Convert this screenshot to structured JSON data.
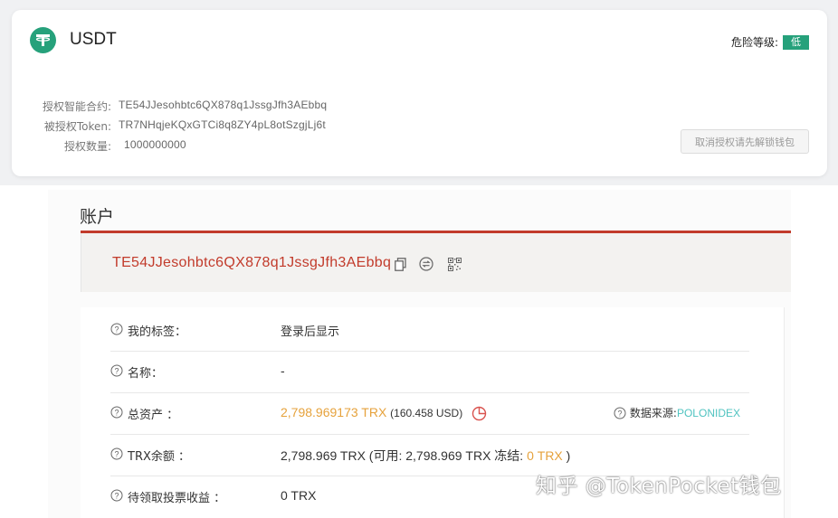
{
  "token_card": {
    "name": "USDT",
    "risk_label": "危险等级:",
    "risk_level": "低",
    "contract_label": "授权智能合约:",
    "contract_value": "TE54JJesohbtc6QX878q1JssgJfh3AEbbq",
    "token_label": "被授权Token:",
    "token_value": "TR7NHqjeKQxGTCi8q8ZY4pL8otSzgjLj6t",
    "amount_label": "授权数量:",
    "amount_value": "1000000000",
    "revoke_button": "取消授权请先解锁钱包"
  },
  "account": {
    "title": "账户",
    "address": "TE54JJesohbtc6QX878q1JssgJfh3AEbbq",
    "rows": [
      {
        "label": "我的标签：",
        "value": "登录后显示"
      },
      {
        "label": "名称：",
        "value": "-"
      },
      {
        "label": "总资产 ：",
        "value": "2,798.969173 TRX",
        "usd": "(160.458 USD)",
        "source_label": "数据来源:",
        "source": "POLONIDEX"
      },
      {
        "label": "TRX余额 ：",
        "value_prefix": "2,798.969 TRX (可用: 2,798.969 TRX  冻结:",
        "frozen": "0 TRX",
        "value_suffix": ")"
      },
      {
        "label": "待领取投票收益 ：",
        "value": "0 TRX"
      }
    ]
  },
  "watermark": "知乎 @TokenPocket钱包",
  "colors": {
    "tether_green": "#26a17b",
    "accent_red": "#c23b2b",
    "asset_orange": "#e6a23c",
    "source_teal": "#4fc3c0"
  },
  "icons": [
    "tether-icon",
    "copy-icon",
    "transfer-icon",
    "qrcode-icon",
    "question-icon",
    "pie-chart-icon"
  ]
}
